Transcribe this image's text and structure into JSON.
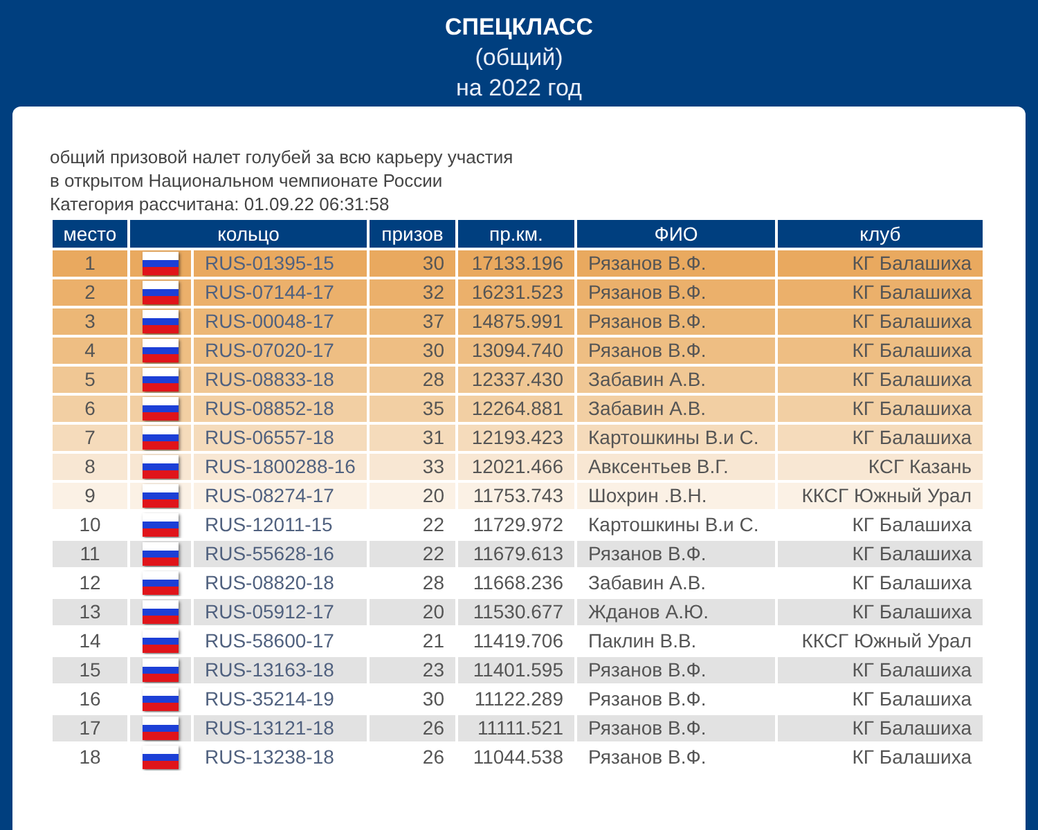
{
  "header": {
    "title": "СПЕЦКЛАСС",
    "subtitle": "(общий)",
    "year": "на 2022 год"
  },
  "description": [
    "общий призовой налет голубей за всю карьеру участия",
    "в открытом Национальном чемпионате России",
    "Категория рассчитана: 01.09.22 06:31:58"
  ],
  "table": {
    "columns": [
      "место",
      "кольцо",
      "призов",
      "пр.км.",
      "ФИО",
      "клуб"
    ],
    "rows": [
      {
        "place": "1",
        "ring": "RUS-01395-15",
        "prizes": "30",
        "km": "17133.196",
        "name": "Рязанов В.Ф.",
        "club": "КГ Балашиха",
        "color": "#e9a95f"
      },
      {
        "place": "2",
        "ring": "RUS-07144-17",
        "prizes": "32",
        "km": "16231.523",
        "name": "Рязанов В.Ф.",
        "club": "КГ Балашиха",
        "color": "#ebb06b"
      },
      {
        "place": "3",
        "ring": "RUS-00048-17",
        "prizes": "37",
        "km": "14875.991",
        "name": "Рязанов В.Ф.",
        "club": "КГ Балашиха",
        "color": "#ecb776"
      },
      {
        "place": "4",
        "ring": "RUS-07020-17",
        "prizes": "30",
        "km": "13094.740",
        "name": "Рязанов В.Ф.",
        "club": "КГ Балашиха",
        "color": "#eebe83"
      },
      {
        "place": "5",
        "ring": "RUS-08833-18",
        "prizes": "28",
        "km": "12337.430",
        "name": "Забавин А.В.",
        "club": "КГ Балашиха",
        "color": "#f0c794"
      },
      {
        "place": "6",
        "ring": "RUS-08852-18",
        "prizes": "35",
        "km": "12264.881",
        "name": "Забавин А.В.",
        "club": "КГ Балашиха",
        "color": "#f2cfa3"
      },
      {
        "place": "7",
        "ring": "RUS-06557-18",
        "prizes": "31",
        "km": "12193.423",
        "name": "Картошкины В.и С.",
        "club": "КГ Балашиха",
        "color": "#f5dbbb"
      },
      {
        "place": "8",
        "ring": "RUS-1800288-16",
        "prizes": "33",
        "km": "12021.466",
        "name": "Авксентьев В.Г.",
        "club": "КСГ Казань",
        "color": "#f8e7d3"
      },
      {
        "place": "9",
        "ring": "RUS-08274-17",
        "prizes": "20",
        "km": "11753.743",
        "name": "Шохрин .В.Н.",
        "club": "ККСГ Южный Урал",
        "color": "#fbf1e5"
      },
      {
        "place": "10",
        "ring": "RUS-12011-15",
        "prizes": "22",
        "km": "11729.972",
        "name": "Картошкины В.и С.",
        "club": "КГ Балашиха",
        "color": "#ffffff"
      },
      {
        "place": "11",
        "ring": "RUS-55628-16",
        "prizes": "22",
        "km": "11679.613",
        "name": "Рязанов В.Ф.",
        "club": "КГ Балашиха",
        "color": "#e2e2e2"
      },
      {
        "place": "12",
        "ring": "RUS-08820-18",
        "prizes": "28",
        "km": "11668.236",
        "name": "Забавин А.В.",
        "club": "КГ Балашиха",
        "color": "#ffffff"
      },
      {
        "place": "13",
        "ring": "RUS-05912-17",
        "prizes": "20",
        "km": "11530.677",
        "name": "Жданов А.Ю.",
        "club": "КГ Балашиха",
        "color": "#e2e2e2"
      },
      {
        "place": "14",
        "ring": "RUS-58600-17",
        "prizes": "21",
        "km": "11419.706",
        "name": "Паклин В.В.",
        "club": "ККСГ Южный Урал",
        "color": "#ffffff"
      },
      {
        "place": "15",
        "ring": "RUS-13163-18",
        "prizes": "23",
        "km": "11401.595",
        "name": "Рязанов В.Ф.",
        "club": "КГ Балашиха",
        "color": "#e2e2e2"
      },
      {
        "place": "16",
        "ring": "RUS-35214-19",
        "prizes": "30",
        "km": "11122.289",
        "name": "Рязанов В.Ф.",
        "club": "КГ Балашиха",
        "color": "#ffffff"
      },
      {
        "place": "17",
        "ring": "RUS-13121-18",
        "prizes": "26",
        "km": "11111.521",
        "name": "Рязанов В.Ф.",
        "club": "КГ Балашиха",
        "color": "#e2e2e2"
      },
      {
        "place": "18",
        "ring": "RUS-13238-18",
        "prizes": "26",
        "km": "11044.538",
        "name": "Рязанов В.Ф.",
        "club": "КГ Балашиха",
        "color": "#ffffff"
      }
    ]
  }
}
